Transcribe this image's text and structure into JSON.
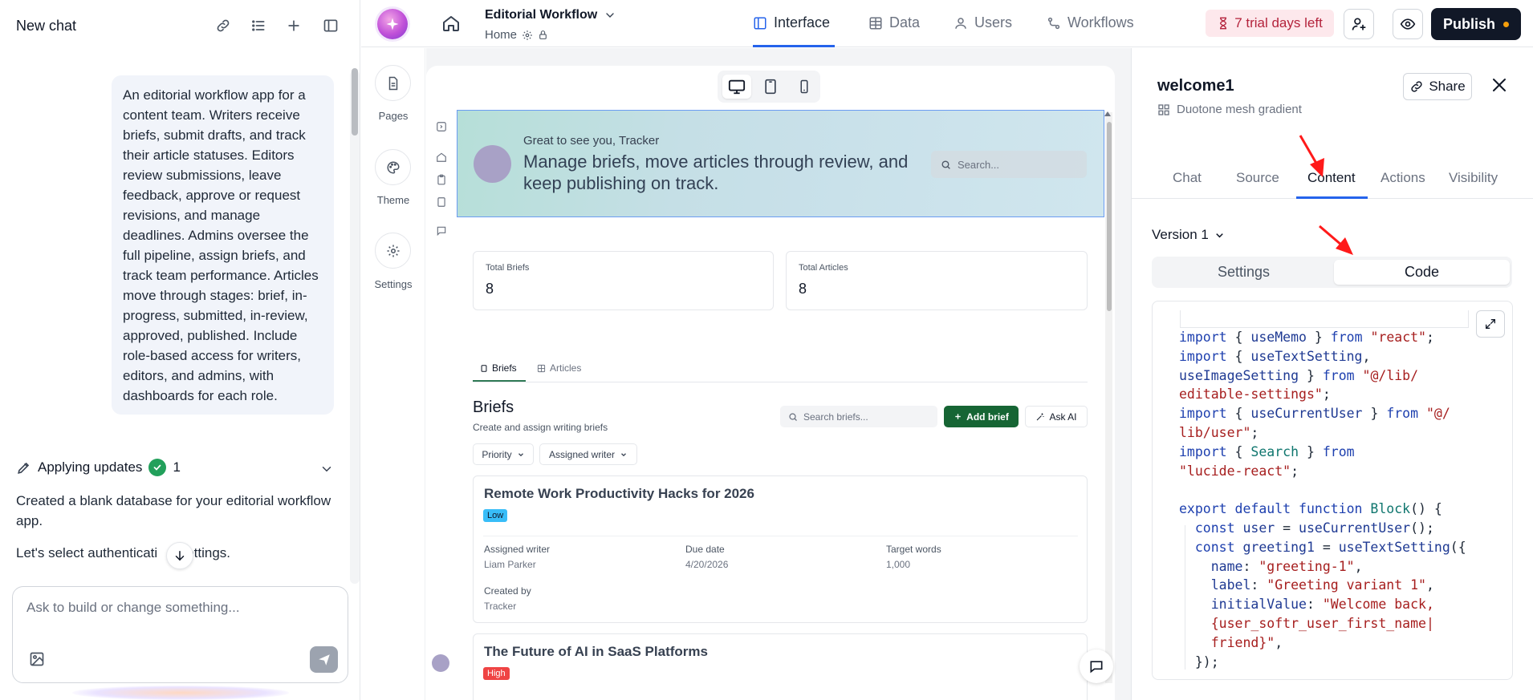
{
  "chat": {
    "title": "New chat",
    "prompt": "An editorial workflow app for a content team. Writers receive briefs, submit drafts, and track their article statuses. Editors review submissions, leave feedback, approve or request revisions, and manage deadlines. Admins oversee the full pipeline, assign briefs, and track team performance. Articles move through stages: brief, in-progress, submitted, in-review, approved, published. Include role-based access for writers, editors, and admins, with dashboards for each role.",
    "applying_label": "Applying updates",
    "applying_count": "1",
    "msg1": "Created a blank database for your editorial workflow app.",
    "msg2": "Let's select authenticati",
    "msg2_tail": "ettings.",
    "input_placeholder": "Ask to build or change something..."
  },
  "topbar": {
    "app_name": "Editorial Workflow",
    "page_name": "Home",
    "tabs": [
      {
        "label": "Interface",
        "icon": "layout-icon",
        "active": true
      },
      {
        "label": "Data",
        "icon": "table-icon",
        "active": false
      },
      {
        "label": "Users",
        "icon": "user-icon",
        "active": false
      },
      {
        "label": "Workflows",
        "icon": "workflow-icon",
        "active": false
      }
    ],
    "trial_label": "7 trial days left",
    "publish_label": "Publish"
  },
  "rail": {
    "pages": "Pages",
    "theme": "Theme",
    "settings": "Settings"
  },
  "preview": {
    "greeting": "Great to see you, Tracker",
    "hero_title": "Manage briefs, move articles through review, and keep publishing on track.",
    "search_placeholder": "Search...",
    "stats": [
      {
        "label": "Total Briefs",
        "value": "8"
      },
      {
        "label": "Total Articles",
        "value": "8"
      }
    ],
    "tabs": [
      {
        "label": "Briefs",
        "active": true
      },
      {
        "label": "Articles",
        "active": false
      }
    ],
    "section_title": "Briefs",
    "section_sub": "Create and assign writing briefs",
    "search_briefs": "Search briefs...",
    "add_brief": "Add brief",
    "ask_ai": "Ask AI",
    "filters": [
      "Priority",
      "Assigned writer"
    ],
    "cards": [
      {
        "title": "Remote Work Productivity Hacks for 2026",
        "priority": "Low",
        "priority_color": "#38bdf8",
        "assigned_writer_label": "Assigned writer",
        "assigned_writer": "Liam Parker",
        "due_date_label": "Due date",
        "due_date": "4/20/2026",
        "target_words_label": "Target words",
        "target_words": "1,000",
        "created_by_label": "Created by",
        "created_by": "Tracker"
      },
      {
        "title": "The Future of AI in SaaS Platforms",
        "priority": "High",
        "priority_color": "#ef4444"
      }
    ]
  },
  "right_panel": {
    "title": "welcome1",
    "subtitle": "Duotone mesh gradient",
    "share": "Share",
    "tabs": [
      "Chat",
      "Source",
      "Content",
      "Actions",
      "Visibility"
    ],
    "active_tab": "Content",
    "version": "Version 1",
    "segments": [
      "Settings",
      "Code"
    ],
    "active_segment": "Code"
  },
  "colors": {
    "accent_blue": "#2563eb",
    "primary_green": "#166534",
    "publish_bg": "#111827",
    "trial_bg": "#fde8ec",
    "annotation_red": "#ff1a1a"
  }
}
